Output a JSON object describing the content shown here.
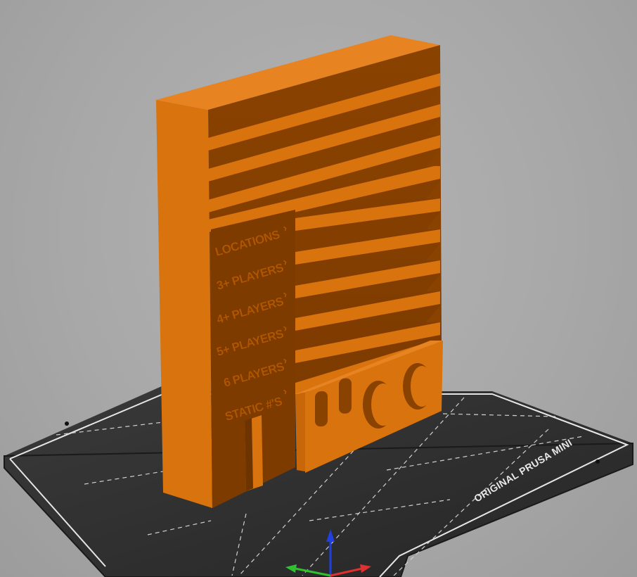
{
  "viewport": {
    "background_color": "#a8a8a8",
    "model_color": "#d9730d",
    "bed_color": "#2a2a2a",
    "bed_grid_color": "#d8d8d8"
  },
  "bed": {
    "brand_text": "ORIGINAL PRUSA MINI"
  },
  "model": {
    "slot_labels": [
      "LOCATIONS",
      "3+ PLAYERS",
      "4+ PLAYERS",
      "5+ PLAYERS",
      "6 PLAYERS",
      "STATIC #'S"
    ],
    "arrow_glyph": "›"
  },
  "axes": {
    "x_color": "#e03030",
    "y_color": "#30c030",
    "z_color": "#2040e0"
  }
}
